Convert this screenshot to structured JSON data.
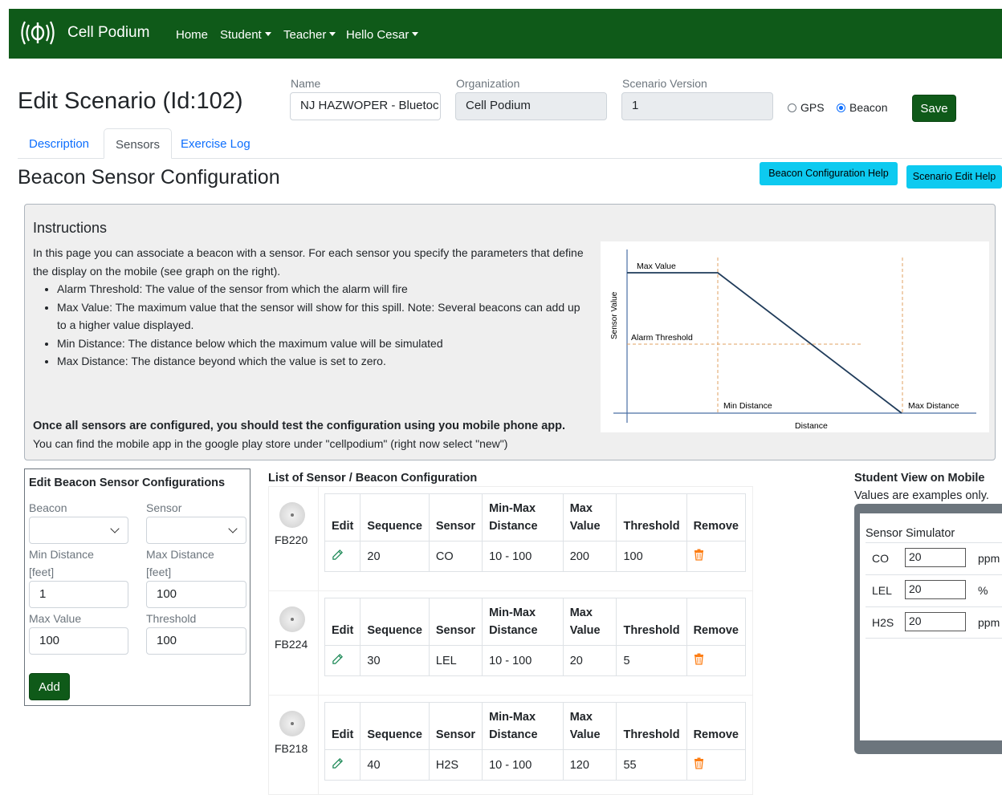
{
  "nav": {
    "brand": "Cell Podium",
    "links": [
      "Home",
      "Student",
      "Teacher",
      "Hello Cesar"
    ]
  },
  "header": {
    "title": "Edit Scenario (Id:102)",
    "name_label": "Name",
    "name_value": "NJ HAZWOPER - Bluetoc",
    "org_label": "Organization",
    "org_value": "Cell Podium",
    "version_label": "Scenario Version",
    "version_value": "1",
    "radio_gps": "GPS",
    "radio_beacon": "Beacon",
    "selected_mode": "Beacon",
    "save_label": "Save"
  },
  "tabs": [
    "Description",
    "Sensors",
    "Exercise Log"
  ],
  "active_tab": "Sensors",
  "section_title": "Beacon Sensor Configuration",
  "help_buttons": {
    "beacon_help": "Beacon Configuration Help",
    "scenario_help": "Scenario Edit Help"
  },
  "instructions": {
    "title": "Instructions",
    "intro": "In this page you can associate a beacon with a sensor. For each sensor you specify the parameters that define the display on the mobile (see graph on the right).",
    "bullets": [
      "Alarm Threshold: The value of the sensor from which the alarm will fire",
      "Max Value: The maximum value that the sensor will show for this spill. Note: Several beacons can add up to a higher value displayed.",
      "Min Distance: The distance below which the maximum value will be simulated",
      "Max Distance: The distance beyond which the value is set to zero."
    ],
    "bold_note": "Once all sensors are configured, you should test the configuration using you mobile phone app.",
    "note": "You can find the mobile app in the google play store under \"cellpodium\" (right now select \"new\")",
    "graph": {
      "max_value": "Max Value",
      "alarm_threshold": "Alarm Threshold",
      "sensor_value": "Sensor Value",
      "min_distance": "Min Distance",
      "max_distance": "Max Distance",
      "distance": "Distance"
    }
  },
  "edit_panel": {
    "title": "Edit Beacon Sensor Configurations",
    "beacon_label": "Beacon",
    "sensor_label": "Sensor",
    "min_dist_label": "Min Distance [feet]",
    "max_dist_label": "Max Distance [feet]",
    "min_dist_value": "1",
    "max_dist_value": "100",
    "max_value_label": "Max Value",
    "threshold_label": "Threshold",
    "max_value_value": "100",
    "threshold_value": "100",
    "add_label": "Add"
  },
  "list": {
    "title": "List of Sensor / Beacon Configuration",
    "headers": {
      "edit": "Edit",
      "sequence": "Sequence",
      "sensor": "Sensor",
      "minmax": "Min-Max Distance",
      "maxvalue": "Max Value",
      "threshold": "Threshold",
      "remove": "Remove"
    },
    "rows": [
      {
        "beacon": "FB220",
        "sequence": "20",
        "sensor": "CO",
        "distance": "10 - 100",
        "max_value": "200",
        "threshold": "100"
      },
      {
        "beacon": "FB224",
        "sequence": "30",
        "sensor": "LEL",
        "distance": "10 - 100",
        "max_value": "20",
        "threshold": "5"
      },
      {
        "beacon": "FB218",
        "sequence": "40",
        "sensor": "H2S",
        "distance": "10 - 100",
        "max_value": "120",
        "threshold": "55"
      }
    ]
  },
  "student_view": {
    "title": "Student View on Mobile",
    "subtitle": "Values are examples only.",
    "simulator_title": "Sensor Simulator",
    "sensors": [
      {
        "name": "CO",
        "value": "20",
        "unit": "ppm"
      },
      {
        "name": "LEL",
        "value": "20",
        "unit": "%"
      },
      {
        "name": "H2S",
        "value": "20",
        "unit": "ppm"
      }
    ]
  },
  "colors": {
    "brand_green": "#0f5a19",
    "help_cyan": "#0dcaf0",
    "link_blue": "#0d6efd",
    "trash_orange": "#fd7e14"
  }
}
